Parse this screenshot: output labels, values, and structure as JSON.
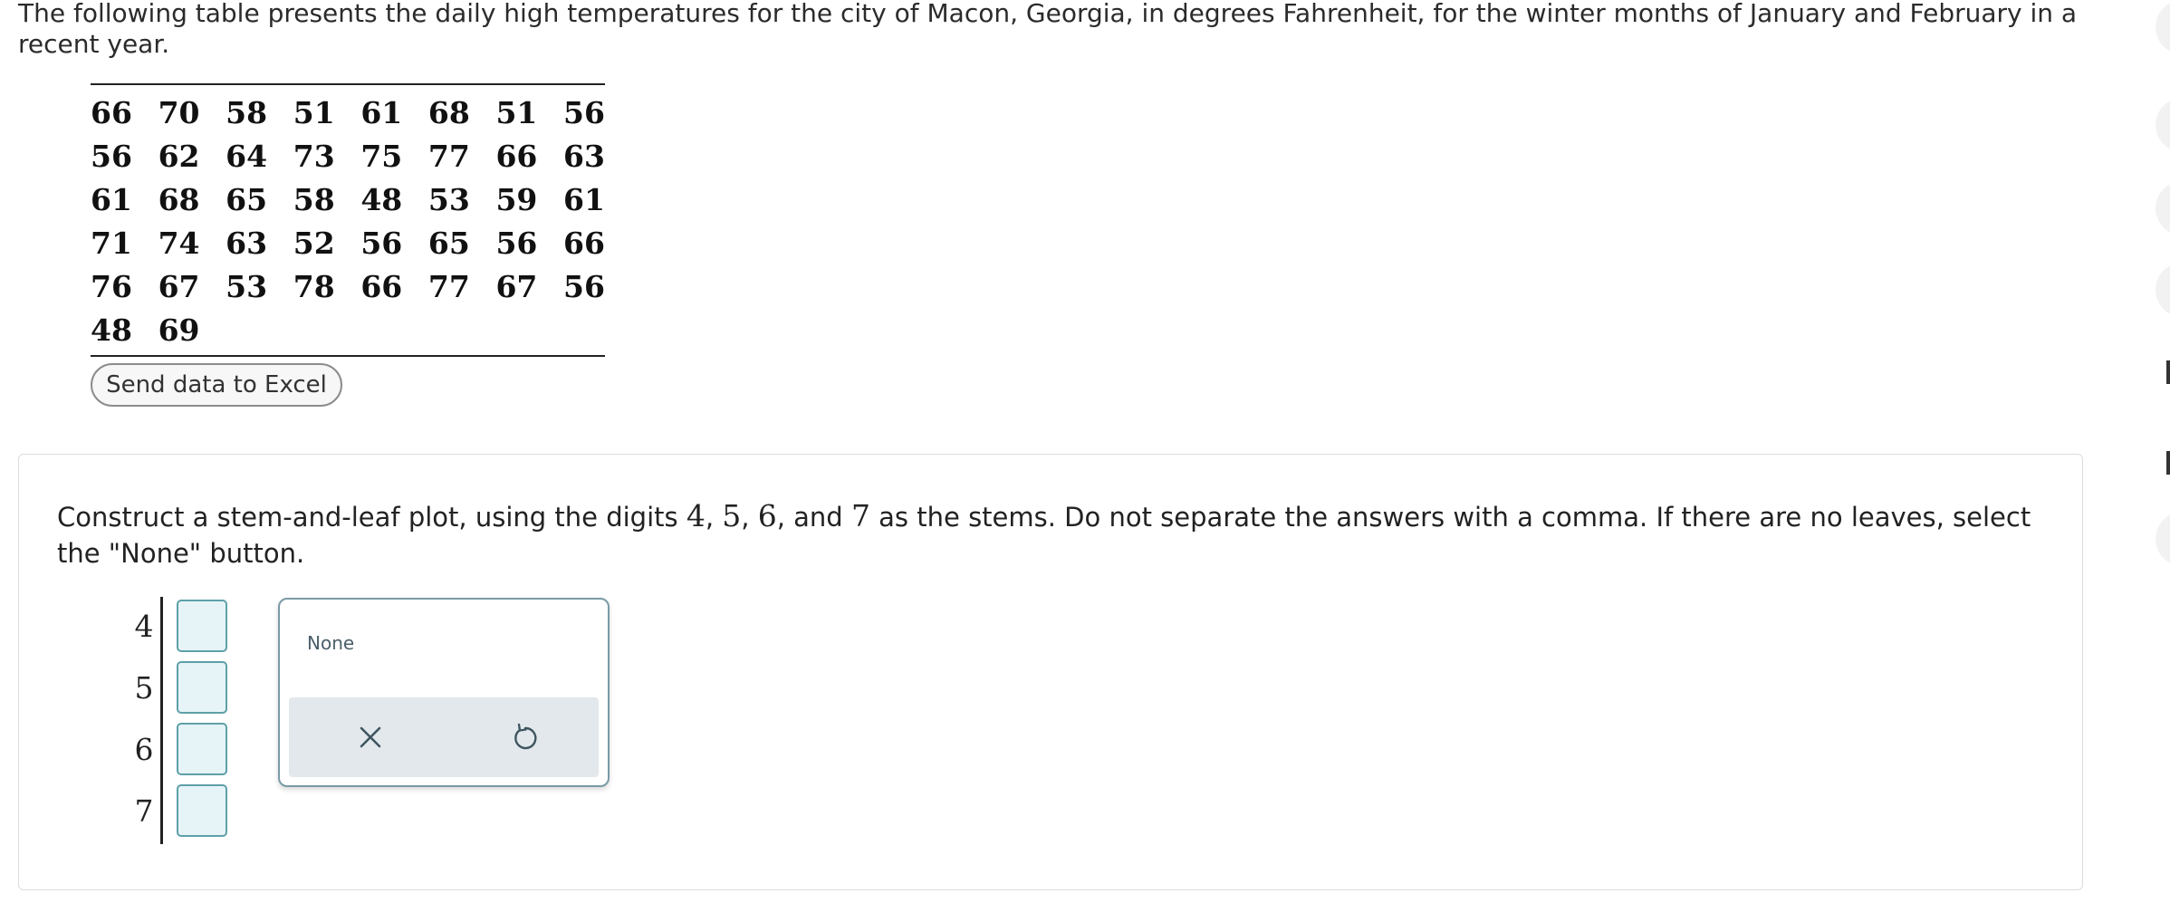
{
  "intro_text": "The following table presents the daily high temperatures for the city of Macon, Georgia, in degrees Fahrenheit, for the winter months of January and February in a recent year.",
  "table_rows": [
    [
      "66",
      "70",
      "58",
      "51",
      "61",
      "68",
      "51",
      "56"
    ],
    [
      "56",
      "62",
      "64",
      "73",
      "75",
      "77",
      "66",
      "63"
    ],
    [
      "61",
      "68",
      "65",
      "58",
      "48",
      "53",
      "59",
      "61"
    ],
    [
      "71",
      "74",
      "63",
      "52",
      "56",
      "65",
      "56",
      "66"
    ],
    [
      "76",
      "67",
      "53",
      "78",
      "66",
      "77",
      "67",
      "56"
    ],
    [
      "48",
      "69",
      "",
      "",
      "",
      "",
      "",
      ""
    ]
  ],
  "excel_button_label": "Send data to Excel",
  "question": {
    "part1": "Construct a stem-and-leaf plot, using the digits ",
    "d4": "4",
    "sep1": ", ",
    "d5": "5",
    "sep2": ", ",
    "d6": "6",
    "sep3": ", and ",
    "d7": "7",
    "part2": " as the stems. Do not separate the answers with a comma. If there are no leaves, select the \"None\" button."
  },
  "stems": [
    "4",
    "5",
    "6",
    "7"
  ],
  "leaves": [
    "",
    "",
    "",
    ""
  ],
  "palette": {
    "none_label": "None",
    "clear_icon": "close-icon",
    "undo_icon": "undo-icon"
  },
  "colors": {
    "input_border": "#5ea0a8",
    "input_fill": "#e6f4f8",
    "palette_bar": "#e2e8eb"
  }
}
